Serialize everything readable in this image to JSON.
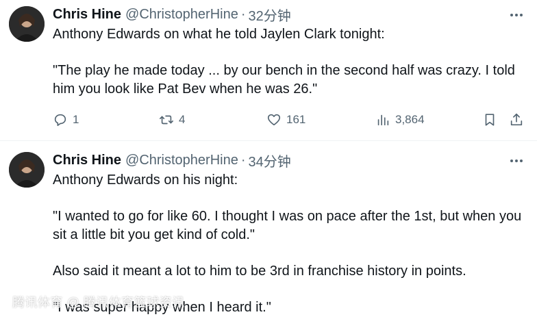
{
  "tweets": [
    {
      "author_name": "Chris Hine",
      "handle": "@ChristopherHine",
      "separator": "·",
      "time": "32分钟",
      "text_lines": [
        "Anthony Edwards on what he told Jaylen Clark tonight:",
        "\"The play he made today ... by our bench in the second half was crazy. I told him you look like Pat Bev when he was 26.\""
      ],
      "replies": "1",
      "reposts": "4",
      "likes": "161",
      "views": "3,864"
    },
    {
      "author_name": "Chris Hine",
      "handle": "@ChristopherHine",
      "separator": "·",
      "time": "34分钟",
      "text_lines": [
        "Anthony Edwards on his night:",
        "\"I wanted to go for like 60. I thought I was on pace after the 1st, but when you sit a little bit you get kind of cold.\"",
        "Also said it meant a lot to him to be 3rd in franchise history in points.",
        "\"I was super happy when I heard it.\""
      ]
    }
  ],
  "watermark": "腾讯体育 @ 腾讯体育篮球资讯",
  "icons": {
    "more": "more-horizontal-icon",
    "reply": "reply-icon",
    "repost": "repost-icon",
    "like": "heart-icon",
    "views": "views-chart-icon",
    "bookmark": "bookmark-icon",
    "share": "share-icon"
  },
  "colors": {
    "text": "#0f1419",
    "secondary": "#536471",
    "divider": "#eff3f4"
  }
}
